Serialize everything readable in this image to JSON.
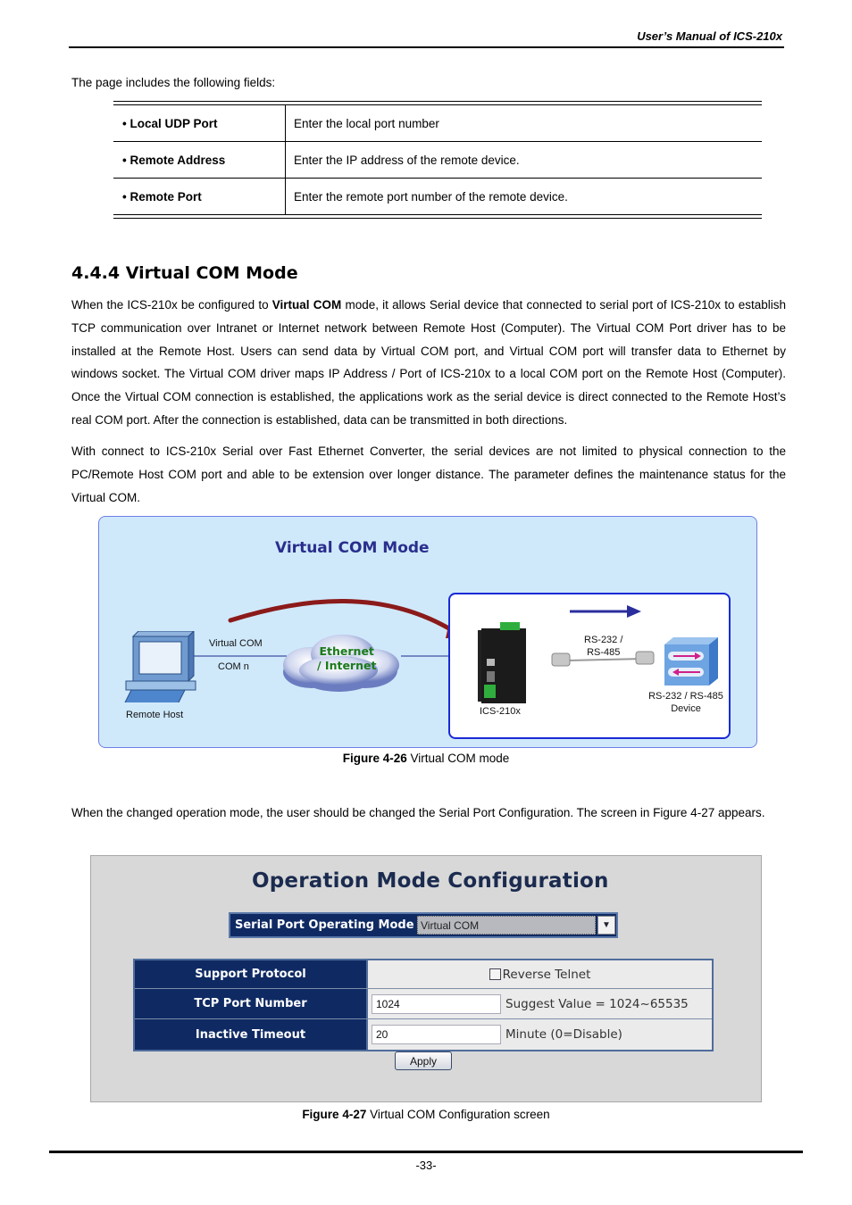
{
  "header": {
    "title": "User’s Manual of ICS-210x"
  },
  "intro": "The page includes the following fields:",
  "fields": [
    {
      "name": "• Local UDP Port",
      "description": "Enter the local port number"
    },
    {
      "name": "• Remote Address",
      "description": "Enter the IP address of the remote device."
    },
    {
      "name": "• Remote Port",
      "description": "Enter the remote port number of the remote device."
    }
  ],
  "section": {
    "title": "4.4.4 Virtual COM Mode",
    "para1_pre": "When the ICS-210x be configured to ",
    "para1_bold": "Virtual COM",
    "para1_post": " mode, it allows Serial device that connected to serial port of ICS-210x to establish TCP communication over Intranet or Internet network between Remote Host (Computer). The Virtual COM Port driver has to be installed at the Remote Host. Users can send data by Virtual COM port, and Virtual COM port will transfer data to Ethernet by windows socket. The Virtual COM driver maps IP Address / Port of ICS-210x to a local COM port on the Remote Host (Computer). Once the Virtual COM connection is established, the applications work as the serial device is direct connected to the Remote Host’s real COM port. After the connection is established, data can be transmitted in both directions.",
    "para2": "With connect to ICS-210x Serial over Fast Ethernet Converter, the serial devices are not limited to physical connection to the PC/Remote Host COM port and able to be extension over longer distance. The parameter defines the maintenance status for the Virtual COM.",
    "para3": "When the changed operation mode, the user should be changed the Serial Port Configuration. The screen in Figure 4-27 appears."
  },
  "figure1": {
    "title": "Virtual COM Mode",
    "remote_host": "Remote Host",
    "virtual_com": "Virtual COM",
    "com_n": "COM n",
    "cloud_line1": "Ethernet",
    "cloud_line2": "/ Internet",
    "device": "ICS-210x",
    "serial_line1": "RS-232 /",
    "serial_line2": "RS-485",
    "serial_device_line1": "RS-232 / RS-485",
    "serial_device_line2": "Device",
    "caption_bold": "Figure 4-26",
    "caption_text": " Virtual COM mode",
    "colors": {
      "panel_bg": "#cfe9fb",
      "title": "#2a2e8c",
      "arc": "#8b1a1a",
      "inner_border": "#1a2ad6",
      "cloud_text": "#1a7a1a"
    }
  },
  "figure2": {
    "title": "Operation Mode Configuration",
    "mode_label": "Serial Port Operating Mode",
    "mode_value": "Virtual COM",
    "rows": [
      {
        "label": "Support Protocol",
        "checkbox_label": "Reverse Telnet",
        "checked": false
      },
      {
        "label": "TCP Port Number",
        "value": "1024",
        "hint": "Suggest Value = 1024~65535"
      },
      {
        "label": "Inactive Timeout",
        "value": "20",
        "hint": "Minute (0=Disable)"
      }
    ],
    "apply_label": "Apply",
    "caption_bold": "Figure 4-27",
    "caption_text": " Virtual COM Configuration screen",
    "colors": {
      "header_bg": "#0f2a63",
      "panel_bg": "#d8d8d8"
    }
  },
  "footer": {
    "page_number": "-33-"
  }
}
